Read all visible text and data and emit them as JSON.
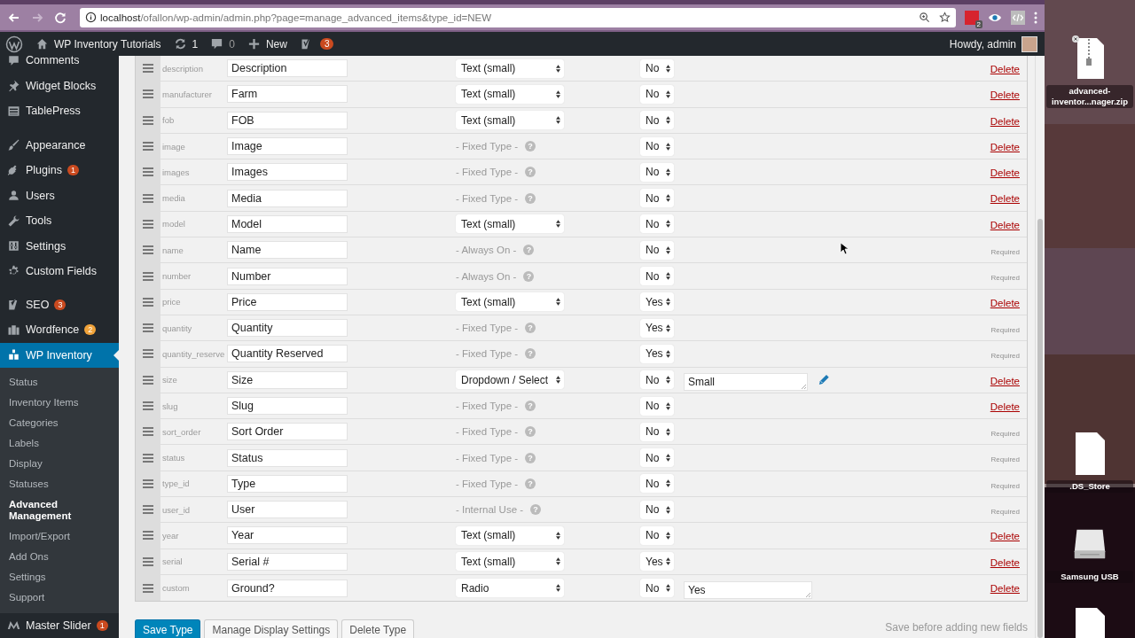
{
  "browser": {
    "url_host": "localhost",
    "url_path": "/ofallon/wp-admin/admin.php?page=manage_advanced_items&type_id=NEW",
    "extension_badge": "2"
  },
  "admin_bar": {
    "site": "WP Inventory Tutorials",
    "updates": "1",
    "comments": "0",
    "new": "New",
    "seo_badge": "3",
    "greeting": "Howdy, admin"
  },
  "sidebar": {
    "groups": [
      [
        {
          "label": "Comments",
          "selected": false
        },
        {
          "label": "Widget Blocks",
          "selected": false
        },
        {
          "label": "TablePress",
          "selected": false
        }
      ],
      [
        {
          "label": "Appearance",
          "selected": false
        },
        {
          "label": "Plugins",
          "selected": false,
          "badge": {
            "text": "1",
            "color": "#ca4a1f"
          }
        },
        {
          "label": "Users",
          "selected": false
        },
        {
          "label": "Tools",
          "selected": false
        },
        {
          "label": "Settings",
          "selected": false
        },
        {
          "label": "Custom Fields",
          "selected": false
        }
      ],
      [
        {
          "label": "SEO",
          "selected": false,
          "badge": {
            "text": "3",
            "color": "#ca4a1f"
          }
        },
        {
          "label": "Wordfence",
          "selected": false,
          "badge": {
            "text": "2",
            "color": "#f0a33a"
          }
        },
        {
          "label": "WP Inventory",
          "selected": true,
          "children": [
            {
              "label": "Status",
              "selected": false
            },
            {
              "label": "Inventory Items",
              "selected": false
            },
            {
              "label": "Categories",
              "selected": false
            },
            {
              "label": "Labels",
              "selected": false
            },
            {
              "label": "Display",
              "selected": false
            },
            {
              "label": "Statuses",
              "selected": false
            },
            {
              "label": "Advanced Management",
              "selected": true
            },
            {
              "label": "Import/Export",
              "selected": false
            },
            {
              "label": "Add Ons",
              "selected": false
            },
            {
              "label": "Settings",
              "selected": false
            },
            {
              "label": "Support",
              "selected": false
            }
          ]
        }
      ],
      [
        {
          "label": "Master Slider",
          "selected": false,
          "badge": {
            "text": "1",
            "color": "#ca4a1f"
          }
        }
      ]
    ]
  },
  "fields": [
    {
      "slug": "description",
      "name": "Description",
      "type": {
        "kind": "select",
        "value": "Text (small)"
      },
      "required": "No",
      "has_editor": false,
      "action": {
        "kind": "delete",
        "label": "Delete"
      }
    },
    {
      "slug": "manufacturer",
      "name": "Farm",
      "type": {
        "kind": "select",
        "value": "Text (small)"
      },
      "required": "No",
      "has_editor": false,
      "action": {
        "kind": "delete",
        "label": "Delete"
      }
    },
    {
      "slug": "fob",
      "name": "FOB",
      "type": {
        "kind": "select",
        "value": "Text (small)"
      },
      "required": "No",
      "has_editor": false,
      "action": {
        "kind": "delete",
        "label": "Delete"
      }
    },
    {
      "slug": "image",
      "name": "Image",
      "type": {
        "kind": "note",
        "text": "- Fixed Type -",
        "help": "?"
      },
      "required": "No",
      "has_editor": false,
      "action": {
        "kind": "delete",
        "label": "Delete"
      }
    },
    {
      "slug": "images",
      "name": "Images",
      "type": {
        "kind": "note",
        "text": "- Fixed Type -",
        "help": "?"
      },
      "required": "No",
      "has_editor": false,
      "action": {
        "kind": "delete",
        "label": "Delete"
      }
    },
    {
      "slug": "media",
      "name": "Media",
      "type": {
        "kind": "note",
        "text": "- Fixed Type -",
        "help": "?"
      },
      "required": "No",
      "has_editor": false,
      "action": {
        "kind": "delete",
        "label": "Delete"
      }
    },
    {
      "slug": "model",
      "name": "Model",
      "type": {
        "kind": "select",
        "value": "Text (small)"
      },
      "required": "No",
      "has_editor": false,
      "action": {
        "kind": "delete",
        "label": "Delete"
      }
    },
    {
      "slug": "name",
      "name": "Name",
      "type": {
        "kind": "note",
        "text": "- Always On -",
        "help": "?"
      },
      "required": "No",
      "has_editor": false,
      "action": {
        "kind": "required",
        "label": "Required"
      }
    },
    {
      "slug": "number",
      "name": "Number",
      "type": {
        "kind": "note",
        "text": "- Always On -",
        "help": "?"
      },
      "required": "No",
      "has_editor": false,
      "action": {
        "kind": "required",
        "label": "Required"
      }
    },
    {
      "slug": "price",
      "name": "Price",
      "type": {
        "kind": "select",
        "value": "Text (small)"
      },
      "required": "Yes",
      "has_editor": false,
      "action": {
        "kind": "delete",
        "label": "Delete"
      }
    },
    {
      "slug": "quantity",
      "name": "Quantity",
      "type": {
        "kind": "note",
        "text": "- Fixed Type -",
        "help": "?"
      },
      "required": "Yes",
      "has_editor": false,
      "action": {
        "kind": "required",
        "label": "Required"
      }
    },
    {
      "slug": "quantity_reserve",
      "name": "Quantity Reserved",
      "type": {
        "kind": "note",
        "text": "- Fixed Type -",
        "help": "?"
      },
      "required": "Yes",
      "has_editor": false,
      "action": {
        "kind": "required",
        "label": "Required"
      }
    },
    {
      "slug": "size",
      "name": "Size",
      "type": {
        "kind": "select",
        "value": "Dropdown / Select"
      },
      "required": "No",
      "value": "Small",
      "has_editor": true,
      "action": {
        "kind": "delete",
        "label": "Delete"
      }
    },
    {
      "slug": "slug",
      "name": "Slug",
      "type": {
        "kind": "note",
        "text": "- Fixed Type -",
        "help": "?"
      },
      "required": "No",
      "has_editor": false,
      "action": {
        "kind": "delete",
        "label": "Delete"
      }
    },
    {
      "slug": "sort_order",
      "name": "Sort Order",
      "type": {
        "kind": "note",
        "text": "- Fixed Type -",
        "help": "?"
      },
      "required": "No",
      "has_editor": false,
      "action": {
        "kind": "required",
        "label": "Required"
      }
    },
    {
      "slug": "status",
      "name": "Status",
      "type": {
        "kind": "note",
        "text": "- Fixed Type -",
        "help": "?"
      },
      "required": "No",
      "has_editor": false,
      "action": {
        "kind": "required",
        "label": "Required"
      }
    },
    {
      "slug": "type_id",
      "name": "Type",
      "type": {
        "kind": "note",
        "text": "- Fixed Type -",
        "help": "?"
      },
      "required": "No",
      "has_editor": false,
      "action": {
        "kind": "required",
        "label": "Required"
      }
    },
    {
      "slug": "user_id",
      "name": "User",
      "type": {
        "kind": "note",
        "text": "- Internal Use -",
        "help": "?"
      },
      "required": "No",
      "has_editor": false,
      "action": {
        "kind": "required",
        "label": "Required"
      }
    },
    {
      "slug": "year",
      "name": "Year",
      "type": {
        "kind": "select",
        "value": "Text (small)"
      },
      "required": "No",
      "has_editor": false,
      "action": {
        "kind": "delete",
        "label": "Delete"
      }
    },
    {
      "slug": "serial",
      "name": "Serial #",
      "type": {
        "kind": "select",
        "value": "Text (small)"
      },
      "required": "Yes",
      "has_editor": false,
      "action": {
        "kind": "delete",
        "label": "Delete"
      }
    },
    {
      "slug": "custom",
      "name": "Ground?",
      "type": {
        "kind": "select",
        "value": "Radio"
      },
      "required": "No",
      "value": "Yes",
      "has_editor": false,
      "action": {
        "kind": "delete",
        "label": "Delete"
      }
    }
  ],
  "footer": {
    "buttons": [
      {
        "label": "Save Type",
        "kind": "primary"
      },
      {
        "label": "Manage Display Settings",
        "kind": "secondary"
      },
      {
        "label": "Delete Type",
        "kind": "secondary"
      }
    ],
    "note": "Save before adding new fields"
  },
  "desktop": {
    "items": [
      {
        "kind": "zip",
        "label": "advanced-inventor...nager.zip"
      },
      {
        "kind": "file",
        "label": ".DS_Store"
      },
      {
        "kind": "drive",
        "label": "Samsung USB"
      },
      {
        "kind": "file"
      }
    ]
  }
}
